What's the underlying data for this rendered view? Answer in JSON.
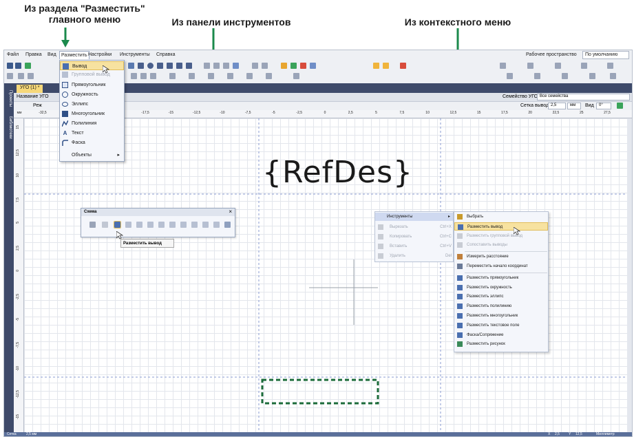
{
  "callouts": {
    "main_menu": "Из раздела \"Разместить\"\nглавного меню",
    "toolbar": "Из панели инструментов",
    "context_menu": "Из контекстного меню"
  },
  "menubar": {
    "items": [
      "Файл",
      "Правка",
      "Вид",
      "Разместить",
      "Настройки",
      "Инструменты",
      "Справка"
    ],
    "workspace_label": "Рабочее пространство",
    "workspace_value": "По умолчанию"
  },
  "left_panel": {
    "tabs": [
      "Проекты",
      "Библиотеки"
    ]
  },
  "doc_tab": {
    "label": "УГО (1) *"
  },
  "propbar": {
    "name_label": "Название УГО",
    "family_label": "Семейство УГО",
    "family_value": "Все семейства"
  },
  "subbar": {
    "mode_label": "Реж",
    "grid_label": "Сетка выводов",
    "grid_value": "2,5",
    "grid_unit": "мм",
    "view_label": "Вид",
    "angle_value": "0°"
  },
  "ruler": {
    "unit": "мм",
    "top_ticks": [
      "-32,5",
      "-30",
      "-22,5",
      "-20",
      "-17,5",
      "-15",
      "-12,5",
      "-10",
      "-7,5",
      "-5",
      "-2,5",
      "0",
      "2,5",
      "5",
      "7,5",
      "10",
      "12,5",
      "15",
      "17,5",
      "20",
      "22,5",
      "25",
      "27,5"
    ],
    "left_ticks": [
      "15",
      "12,5",
      "10",
      "7,5",
      "5",
      "2,5",
      "0",
      "-2,5",
      "-5",
      "-7,5",
      "-10",
      "-12,5",
      "-15"
    ]
  },
  "canvas": {
    "refdes": "{RefDes}"
  },
  "place_menu": {
    "items": [
      {
        "label": "Вывод",
        "icon": "pin-icon",
        "state": "highlighted"
      },
      {
        "label": "Групповой вывод",
        "icon": "group-pin-icon",
        "state": "disabled"
      },
      {
        "label": "Прямоугольник",
        "icon": "rectangle-icon",
        "state": "normal"
      },
      {
        "label": "Окружность",
        "icon": "circle-icon",
        "state": "normal"
      },
      {
        "label": "Эллипс",
        "icon": "ellipse-icon",
        "state": "normal"
      },
      {
        "label": "Многоугольник",
        "icon": "polygon-icon",
        "state": "normal"
      },
      {
        "label": "Полилиния",
        "icon": "polyline-icon",
        "state": "normal"
      },
      {
        "label": "Текст",
        "icon": "text-icon",
        "state": "normal"
      },
      {
        "label": "Фаска",
        "icon": "chamfer-icon",
        "state": "normal"
      },
      {
        "label": "Объекты",
        "icon": "",
        "state": "submenu"
      }
    ]
  },
  "schema_panel": {
    "title": "Схема",
    "close": "×",
    "tooltip": "Разместить вывод"
  },
  "context_menu": {
    "instruments": "Инструменты",
    "left_items": [
      {
        "label": "Вырезать",
        "shortcut": "Ctrl+X"
      },
      {
        "label": "Копировать",
        "shortcut": "Ctrl+C"
      },
      {
        "label": "Вставить",
        "shortcut": "Ctrl+V"
      },
      {
        "label": "Удалить",
        "shortcut": "Del"
      }
    ],
    "submenu": [
      {
        "label": "Выбрать",
        "state": "normal"
      },
      {
        "label": "Разместить вывод",
        "state": "highlighted"
      },
      {
        "label": "Разместить групповой вывод",
        "state": "disabled"
      },
      {
        "label": "Сопоставить выводы",
        "state": "disabled"
      },
      {
        "label": "Измерить расстояние",
        "state": "normal"
      },
      {
        "label": "Переместить начало координат",
        "state": "normal"
      },
      {
        "label": "Разместить прямоугольник",
        "state": "normal"
      },
      {
        "label": "Разместить окружность",
        "state": "normal"
      },
      {
        "label": "Разместить эллипс",
        "state": "normal"
      },
      {
        "label": "Разместить полилинию",
        "state": "normal"
      },
      {
        "label": "Разместить многоугольник",
        "state": "normal"
      },
      {
        "label": "Разместить текстовое поле",
        "state": "normal"
      },
      {
        "label": "Фаска/Сопряжение",
        "state": "normal"
      },
      {
        "label": "Разместить рисунок",
        "state": "normal"
      }
    ]
  },
  "statusbar": {
    "scale_label": "Сетка",
    "scale_value": "2,5 мм",
    "x_label": "X",
    "x_value": "2,5",
    "y_label": "Y",
    "y_value": "12,5",
    "unit": "Миллиметр"
  },
  "colors": {
    "accent_green": "#1b8a4c",
    "highlight": "#f7e2a0",
    "panel_dark": "#3e4a6a",
    "status_blue": "#5a6f9a"
  }
}
